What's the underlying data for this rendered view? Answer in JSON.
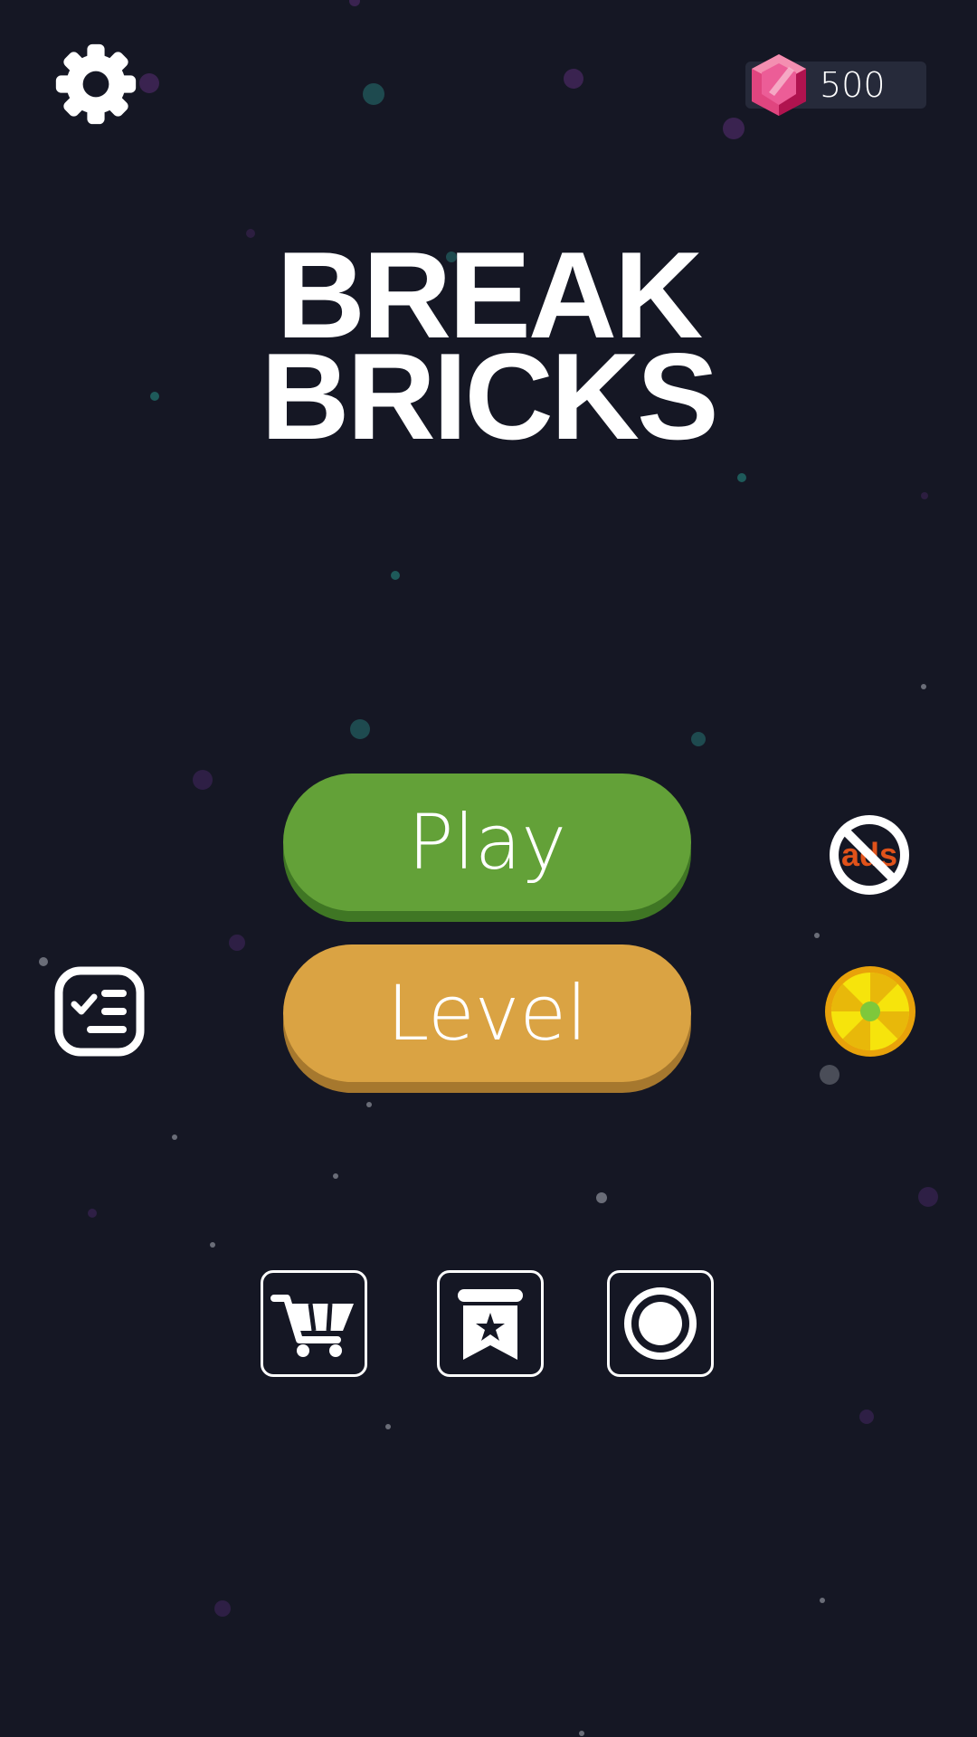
{
  "title": {
    "line1": "BREAK",
    "line2": "BRICKS"
  },
  "currency": {
    "gems": "500"
  },
  "buttons": {
    "play_label": "Play",
    "level_label": "Level",
    "no_ads_text": "ads"
  },
  "icons": {
    "settings": "gear-icon",
    "gem": "gem-icon",
    "tasks": "checklist-icon",
    "no_ads": "no-ads-icon",
    "wheel": "lucky-wheel-icon",
    "shop": "cart-icon",
    "rank": "bookmark-star-icon",
    "record": "record-circle-icon"
  },
  "colors": {
    "background": "#151724",
    "play": "#63a138",
    "level": "#daa343",
    "gem": "#e6407f",
    "no_ads_text": "#e0521a",
    "wheel": "#f2c20a"
  }
}
